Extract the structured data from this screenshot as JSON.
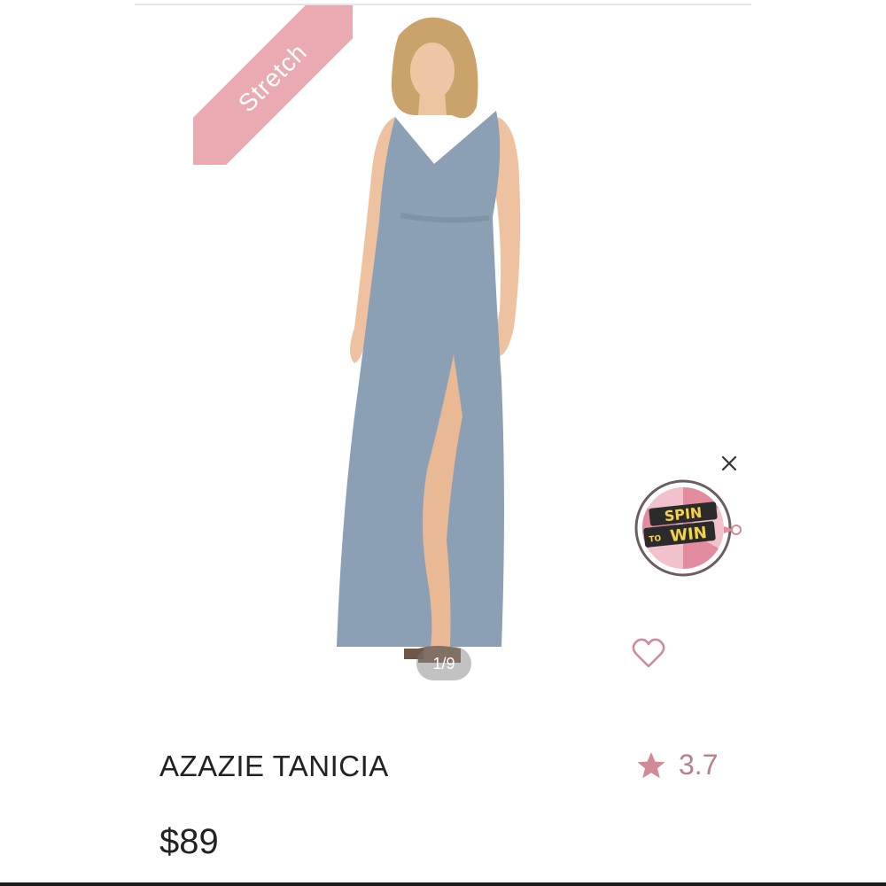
{
  "badge": {
    "label": "Stretch",
    "color": "#e9aab2"
  },
  "gallery": {
    "counter": "1/9"
  },
  "promo": {
    "line1": "SPIN",
    "line2": "TO",
    "line3": "WIN",
    "close_icon": "close-icon"
  },
  "product": {
    "name": "AZAZIE TANICIA",
    "price": "$89",
    "rating": "3.7",
    "dress_color": "#8ba0b4"
  },
  "icons": {
    "wishlist": "heart-icon",
    "rating": "star-icon"
  },
  "colors": {
    "accent": "#d28a99",
    "rating_text": "#b88089"
  }
}
